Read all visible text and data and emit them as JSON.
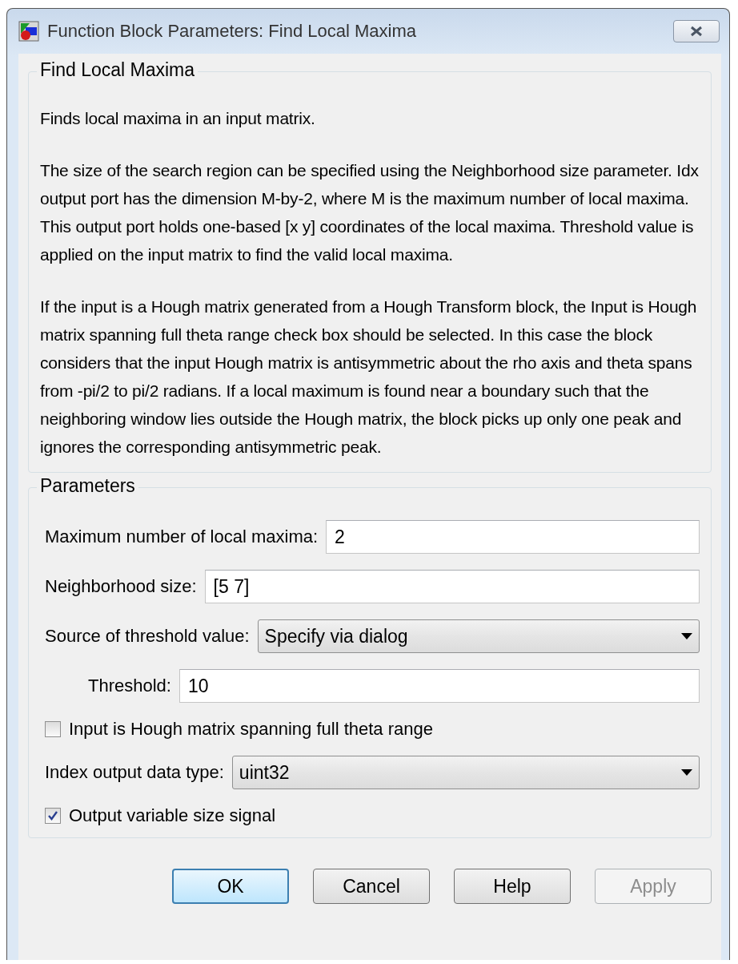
{
  "window": {
    "title": "Function Block Parameters: Find Local Maxima"
  },
  "description": {
    "title": "Find Local Maxima",
    "paragraphs": [
      "Finds local maxima in an input matrix.",
      "The size of the search region can be specified using the Neighborhood size parameter. Idx output port has the dimension M-by-2, where M is the maximum number of local maxima. This output port holds one-based [x y] coordinates of the local maxima. Threshold value is applied on the input matrix to find the valid local maxima.",
      "If the input is a Hough matrix generated from a Hough Transform block, the Input is Hough matrix spanning full theta range check box should be selected. In this case the block considers that the input Hough matrix is antisymmetric about the rho axis and theta spans from -pi/2 to pi/2 radians. If a local maximum is found near a boundary such that the neighboring window lies outside the Hough matrix, the block picks up only one peak and ignores the corresponding antisymmetric peak."
    ]
  },
  "parameters": {
    "title": "Parameters",
    "items": [
      {
        "kind": "text",
        "label": "Maximum number of local maxima:",
        "value": "2",
        "indented": false
      },
      {
        "kind": "text",
        "label": "Neighborhood size:",
        "value": "[5 7]",
        "indented": false
      },
      {
        "kind": "dropdown",
        "label": "Source of threshold value:",
        "value": "Specify via dialog",
        "indented": false
      },
      {
        "kind": "text",
        "label": "Threshold:",
        "value": "10",
        "indented": true
      },
      {
        "kind": "checkbox",
        "label": "Input is Hough matrix spanning full theta range",
        "checked": false
      },
      {
        "kind": "dropdown",
        "label": "Index output data type:",
        "value": "uint32",
        "indented": false
      },
      {
        "kind": "checkbox",
        "label": "Output variable size signal",
        "checked": true
      }
    ]
  },
  "buttons": [
    {
      "label": "OK",
      "default": true,
      "disabled": false
    },
    {
      "label": "Cancel",
      "default": false,
      "disabled": false
    },
    {
      "label": "Help",
      "default": false,
      "disabled": false
    },
    {
      "label": "Apply",
      "default": false,
      "disabled": true
    }
  ]
}
